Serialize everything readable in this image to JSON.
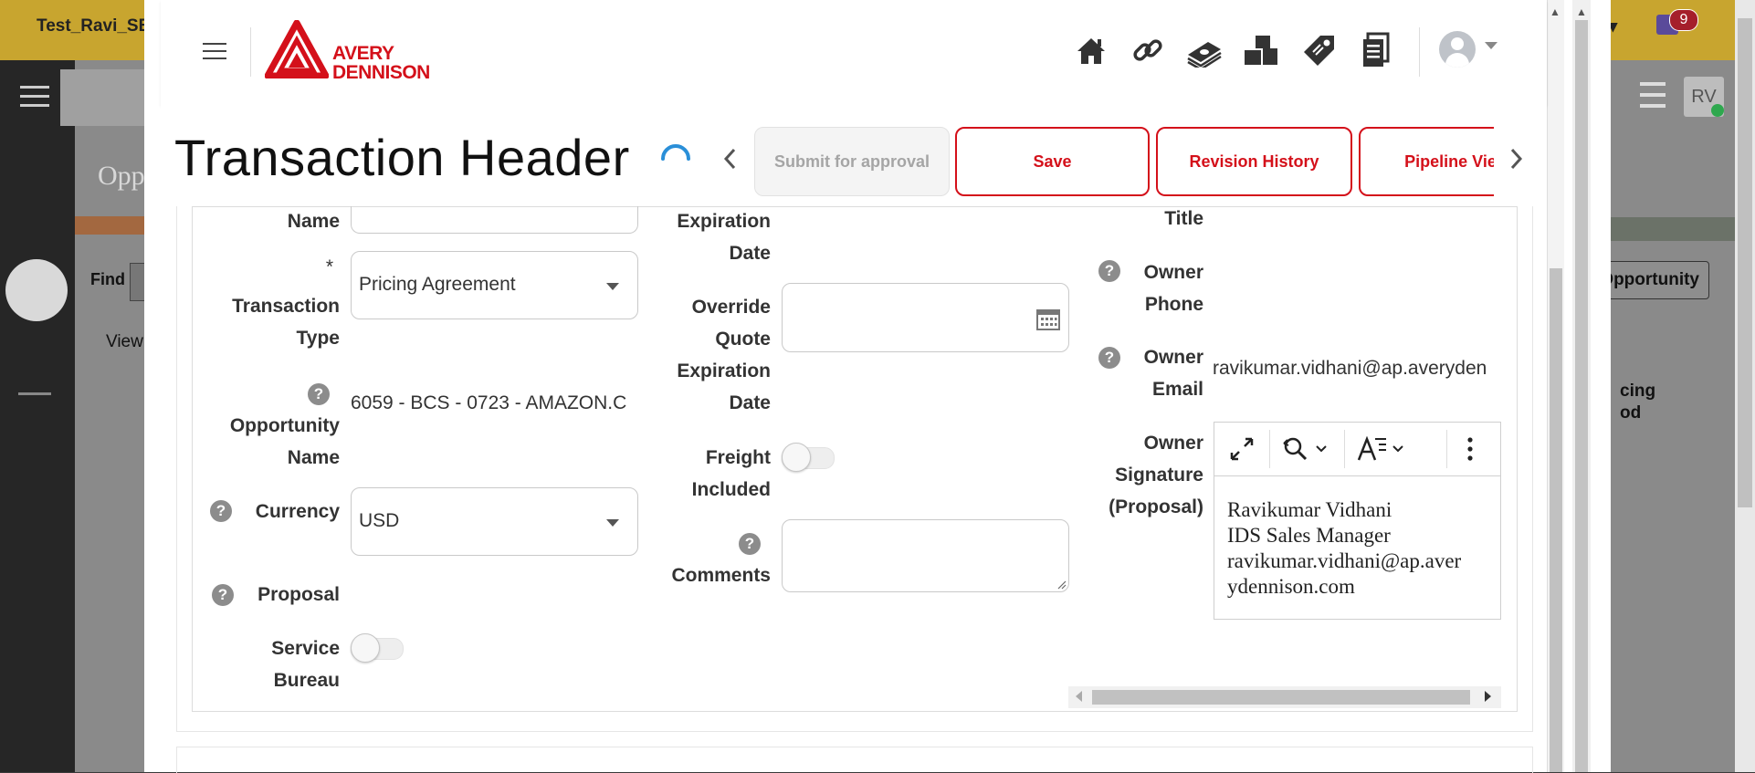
{
  "background": {
    "topbar_left_text": "Test_Ravi_SB",
    "topbar_right_text": "t ▾",
    "notification_count": "9",
    "page_title_partial": "Opp",
    "find_label": "Find",
    "view_label": "View",
    "opportunity_button": "Opportunity",
    "column_header_partial_1": "cing",
    "column_header_partial_2": "od",
    "avatar_initials": "RV"
  },
  "modal": {
    "brand_line1": "AVERY",
    "brand_line2": "DENNISON",
    "page_title": "Transaction Header",
    "actions": {
      "submit": "Submit for approval",
      "save": "Save",
      "revision_history": "Revision History",
      "pipeline_view": "Pipeline View"
    },
    "form": {
      "name_label": "Name",
      "required_mark": "*",
      "transaction_type_label": "Transaction Type",
      "transaction_type_value": "Pricing Agreement",
      "opportunity_name_label": "Opportunity Name",
      "opportunity_name_value": "6059 - BCS - 0723 - AMAZON.C",
      "currency_label": "Currency",
      "currency_value": "USD",
      "proposal_label": "Proposal",
      "service_bureau_label": "Service Bureau",
      "expiration_date_label": "Expiration Date",
      "override_quote_label": "Override Quote Expiration Date",
      "freight_included_label": "Freight Included",
      "comments_label": "Comments",
      "title_label": "Title",
      "owner_phone_label": "Owner Phone",
      "owner_email_label": "Owner Email",
      "owner_email_value": "ravikumar.vidhani@ap.averyden",
      "owner_signature_label": "Owner Signature (Proposal)",
      "signature_lines": [
        "Ravikumar Vidhani",
        "IDS Sales Manager",
        "ravikumar.vidhani@ap.aver",
        "ydennison.com"
      ]
    },
    "help_glyph": "?"
  },
  "icons": [
    "hamburger-icon",
    "home-icon",
    "link-icon",
    "money-icon",
    "boxes-icon",
    "tag-icon",
    "documents-icon",
    "user-avatar-icon",
    "chevron-left-icon",
    "chevron-right-icon",
    "spinner-icon",
    "calendar-icon",
    "dropdown-arrow-icon",
    "expand-icon",
    "find-replace-icon",
    "text-format-icon",
    "more-vertical-icon"
  ],
  "colors": {
    "brand_red": "#d4101a",
    "topbar_gold": "#c8a52f",
    "spinner_blue": "#2a8fd8"
  }
}
